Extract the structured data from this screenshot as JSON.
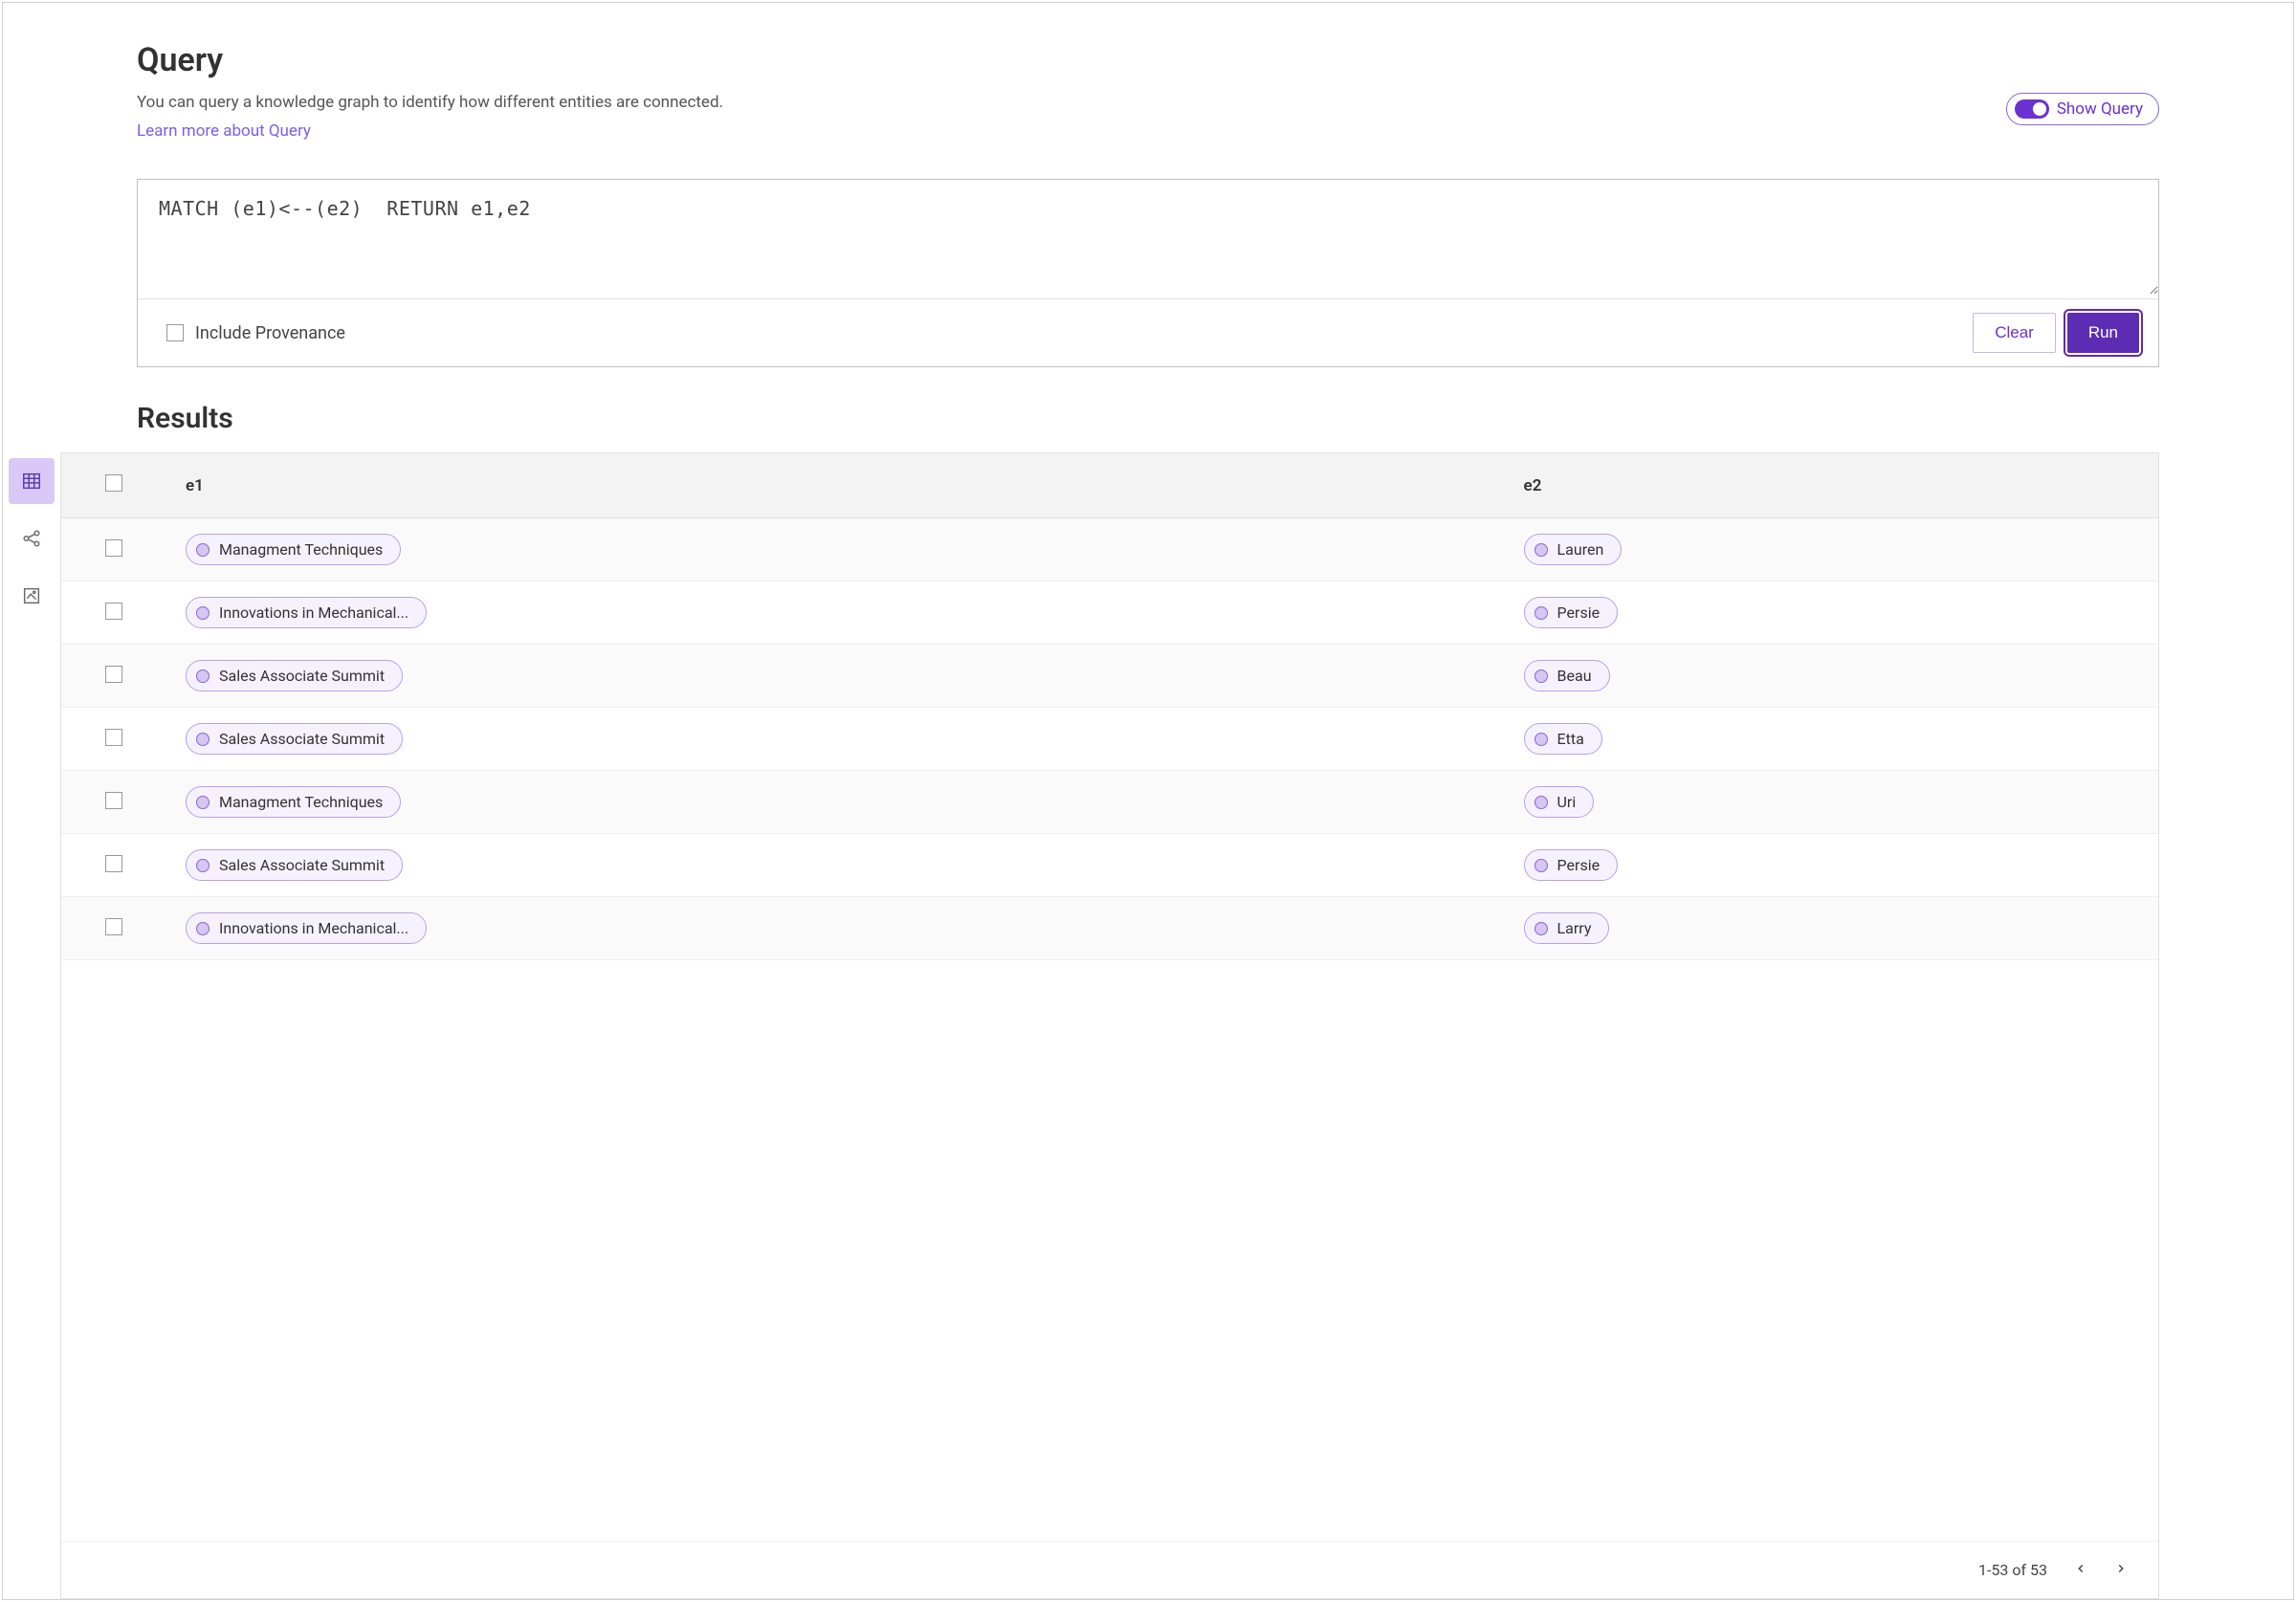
{
  "header": {
    "title": "Query",
    "subtitle": "You can query a knowledge graph to identify how different entities are connected.",
    "learn_more_label": "Learn more about Query",
    "show_query_label": "Show Query"
  },
  "query": {
    "text": "MATCH (e1)<--(e2)  RETURN e1,e2",
    "include_provenance_label": "Include Provenance",
    "clear_label": "Clear",
    "run_label": "Run"
  },
  "results": {
    "title": "Results",
    "columns": [
      "e1",
      "e2"
    ],
    "rows": [
      {
        "e1": "Managment Techniques",
        "e2": "Lauren"
      },
      {
        "e1": "Innovations in Mechanical...",
        "e2": "Persie"
      },
      {
        "e1": "Sales Associate Summit",
        "e2": "Beau"
      },
      {
        "e1": "Sales Associate Summit",
        "e2": "Etta"
      },
      {
        "e1": "Managment Techniques",
        "e2": "Uri"
      },
      {
        "e1": "Sales Associate Summit",
        "e2": "Persie"
      },
      {
        "e1": "Innovations in Mechanical...",
        "e2": "Larry"
      }
    ],
    "pager_text": "1-53 of 53"
  },
  "sidebar": {
    "views": [
      "table",
      "graph",
      "preview"
    ]
  },
  "colors": {
    "accent": "#6c31d1",
    "pill_border": "#b9a0ec",
    "pill_bg": "#f6f2fd"
  }
}
